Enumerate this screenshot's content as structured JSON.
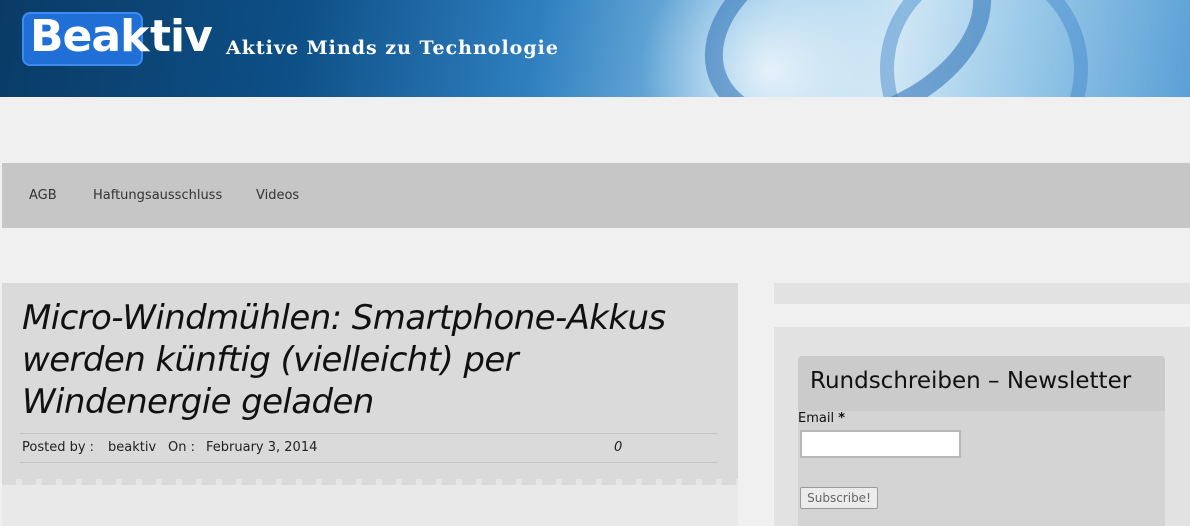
{
  "site": {
    "logo_part1": "Beak",
    "logo_part2": "tiv",
    "tagline": "Aktive Minds zu Technologie"
  },
  "nav": {
    "items": [
      {
        "label": "AGB"
      },
      {
        "label": "Haftungsausschluss"
      },
      {
        "label": "Videos"
      }
    ]
  },
  "post": {
    "title": "Micro-Windmühlen: Smartphone-Akkus werden künftig (vielleicht) per Windenergie geladen",
    "posted_by_label": "Posted by :",
    "author": "beaktiv",
    "on_label": "On :",
    "date": "February 3, 2014",
    "comments": "0"
  },
  "sidebar": {
    "newsletter": {
      "title": "Rundschreiben – Newsletter",
      "email_label": "Email",
      "required_marker": "*",
      "email_value": "",
      "subscribe_label": "Subscribe!"
    }
  },
  "colors": {
    "logo_box": "#1f6fd6",
    "nav_bg": "#c6c6c6",
    "card_bg": "#dadada",
    "page_bg": "#f0f0f0"
  }
}
